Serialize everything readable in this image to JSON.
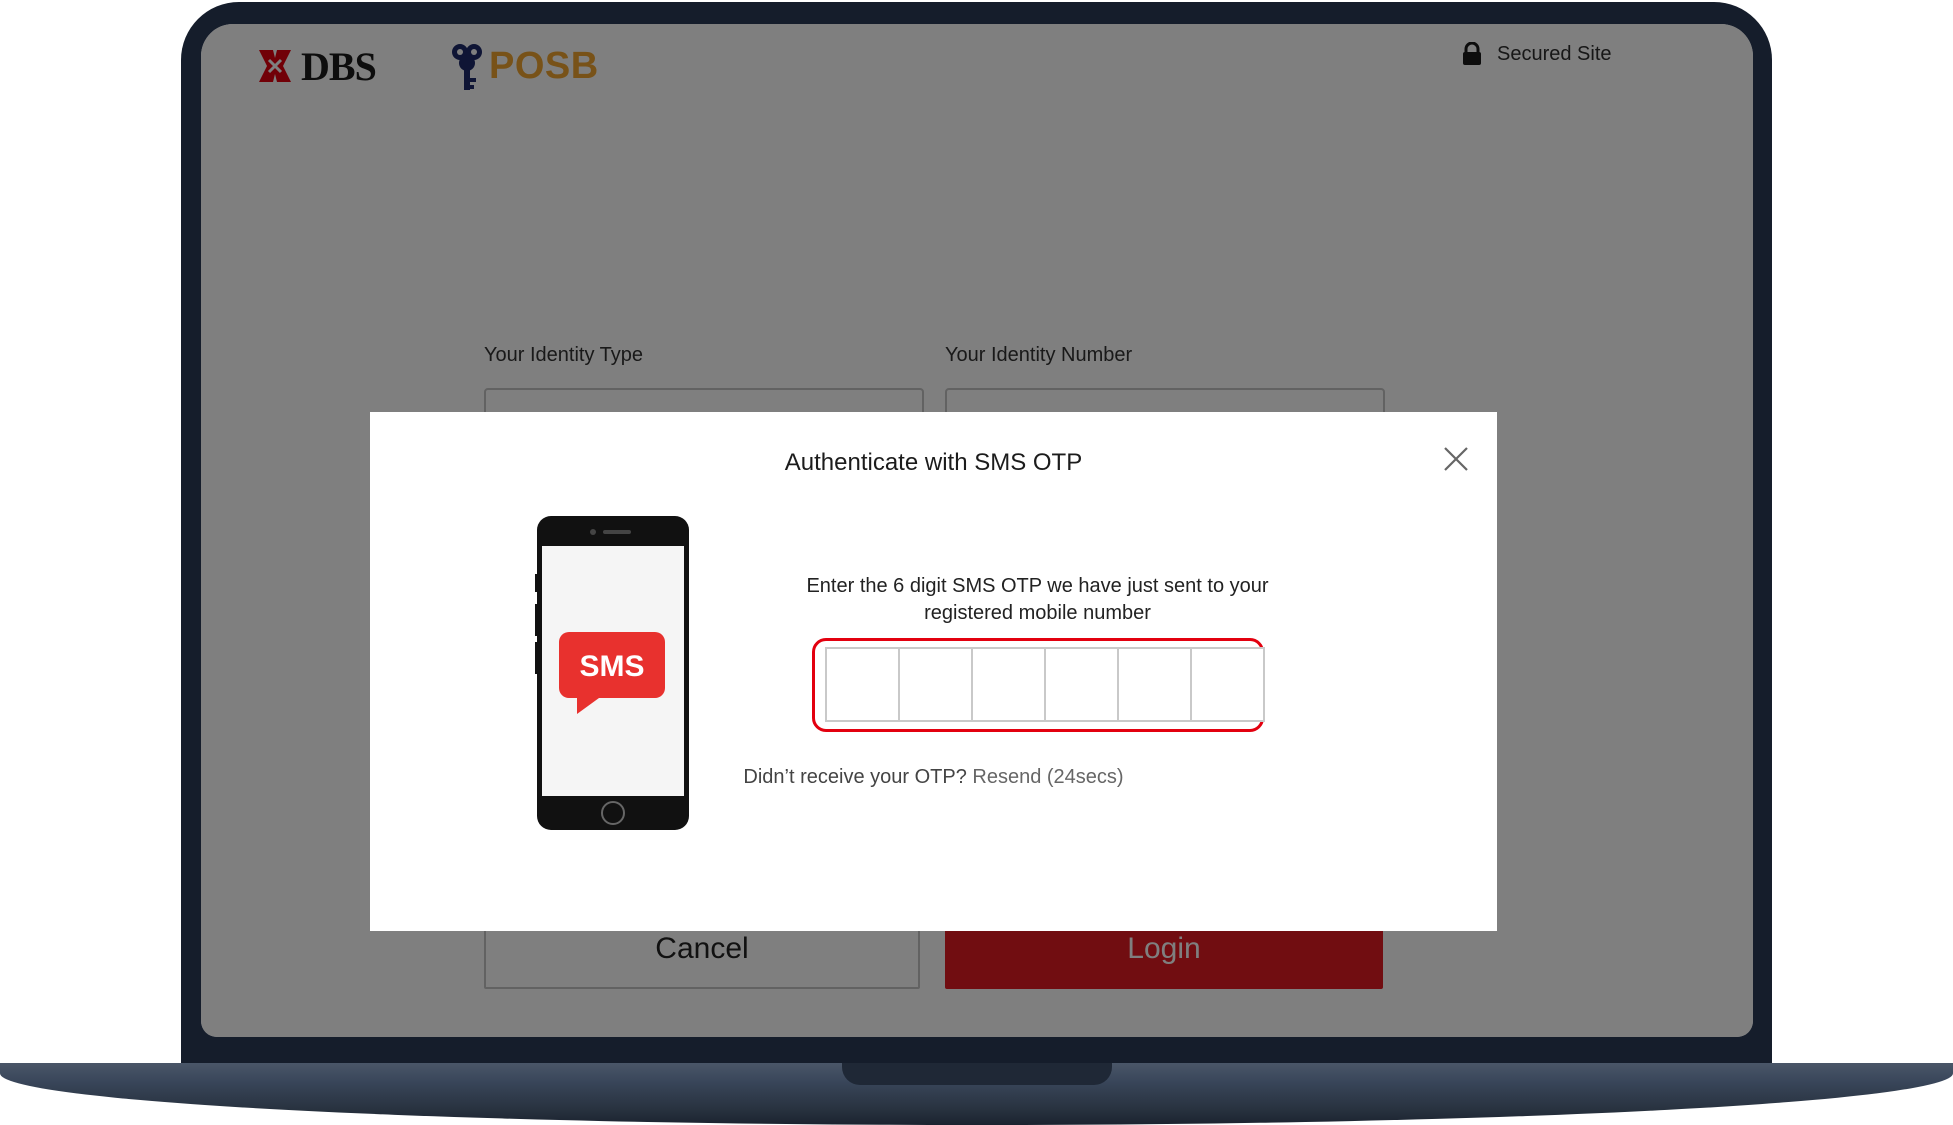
{
  "header": {
    "dbs_logo": "DBS",
    "posb_logo": "POSB",
    "secured_label": "Secured Site"
  },
  "form": {
    "identity_type_label": "Your Identity Type",
    "identity_number_label": "Your Identity Number",
    "cancel_label": "Cancel",
    "login_label": "Login"
  },
  "modal": {
    "title": "Authenticate with SMS OTP",
    "instruction_line1": "Enter the 6 digit SMS OTP we have just sent to your",
    "instruction_line2": "registered mobile number",
    "otp_digits": [
      "",
      "",
      "",
      "",
      "",
      ""
    ],
    "resend_prompt": "Didn’t receive your OTP?",
    "resend_link": "Resend (24secs)",
    "sms_badge": "SMS"
  },
  "colors": {
    "dbs_red": "#e3000f",
    "posb_gold": "#f0a530",
    "posb_navy": "#1f2a6b",
    "login_red": "#e31b23"
  },
  "icons": {
    "lock": "lock-icon",
    "close": "close-icon",
    "phone": "phone-icon"
  }
}
